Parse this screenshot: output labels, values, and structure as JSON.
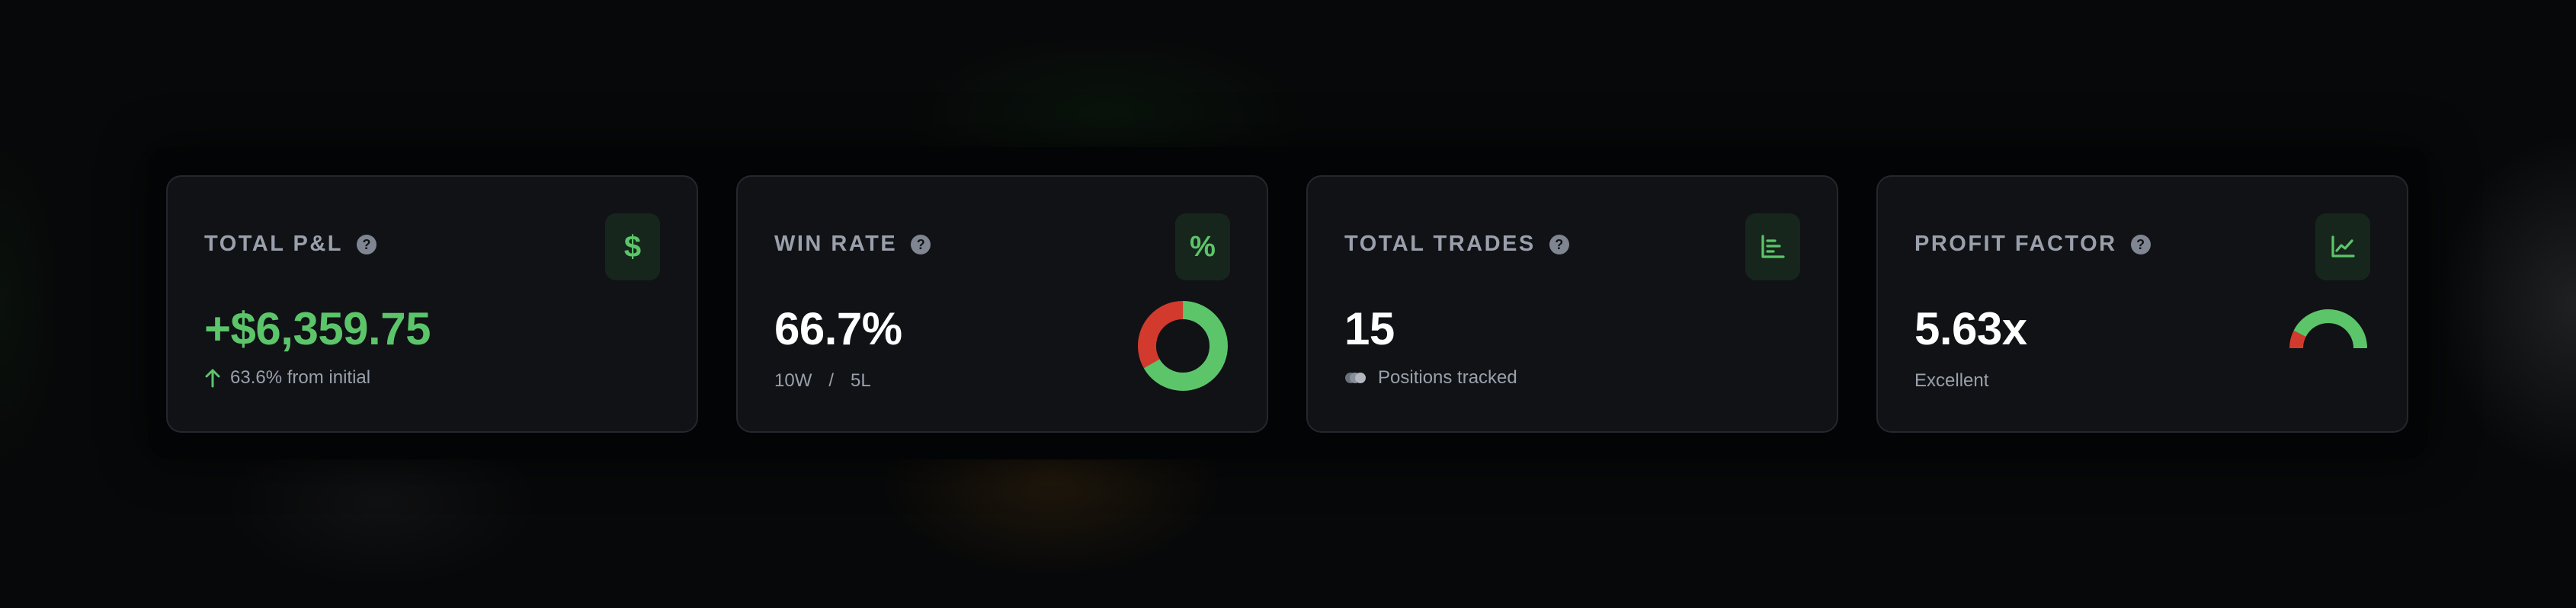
{
  "colors": {
    "positive": "#5cc56a",
    "negative": "#d23a2e",
    "muted": "#9aa0ab",
    "card_bg": "#101216"
  },
  "cards": [
    {
      "title": "TOTAL P&L",
      "help_icon": "question-circle-icon",
      "icon": "dollar-icon",
      "icon_glyph": "$",
      "value": "+$6,359.75",
      "sub_icon": "arrow-up-icon",
      "sub_text": "63.6% from initial"
    },
    {
      "title": "WIN RATE",
      "help_icon": "question-circle-icon",
      "icon": "percent-icon",
      "icon_glyph": "%",
      "value": "66.7%",
      "wins": "10W",
      "separator": "/",
      "losses": "5L",
      "donut": {
        "win_fraction": 0.667,
        "loss_fraction": 0.333
      }
    },
    {
      "title": "TOTAL TRADES",
      "help_icon": "question-circle-icon",
      "icon": "bar-list-icon",
      "value": "15",
      "sub_icon": "coins-stack-icon",
      "sub_text": "Positions tracked"
    },
    {
      "title": "PROFIT FACTOR",
      "help_icon": "question-circle-icon",
      "icon": "line-chart-icon",
      "value": "5.63x",
      "sub_text": "Excellent",
      "gauge": {
        "red_fraction": 0.15,
        "green_fraction": 0.85
      }
    }
  ]
}
